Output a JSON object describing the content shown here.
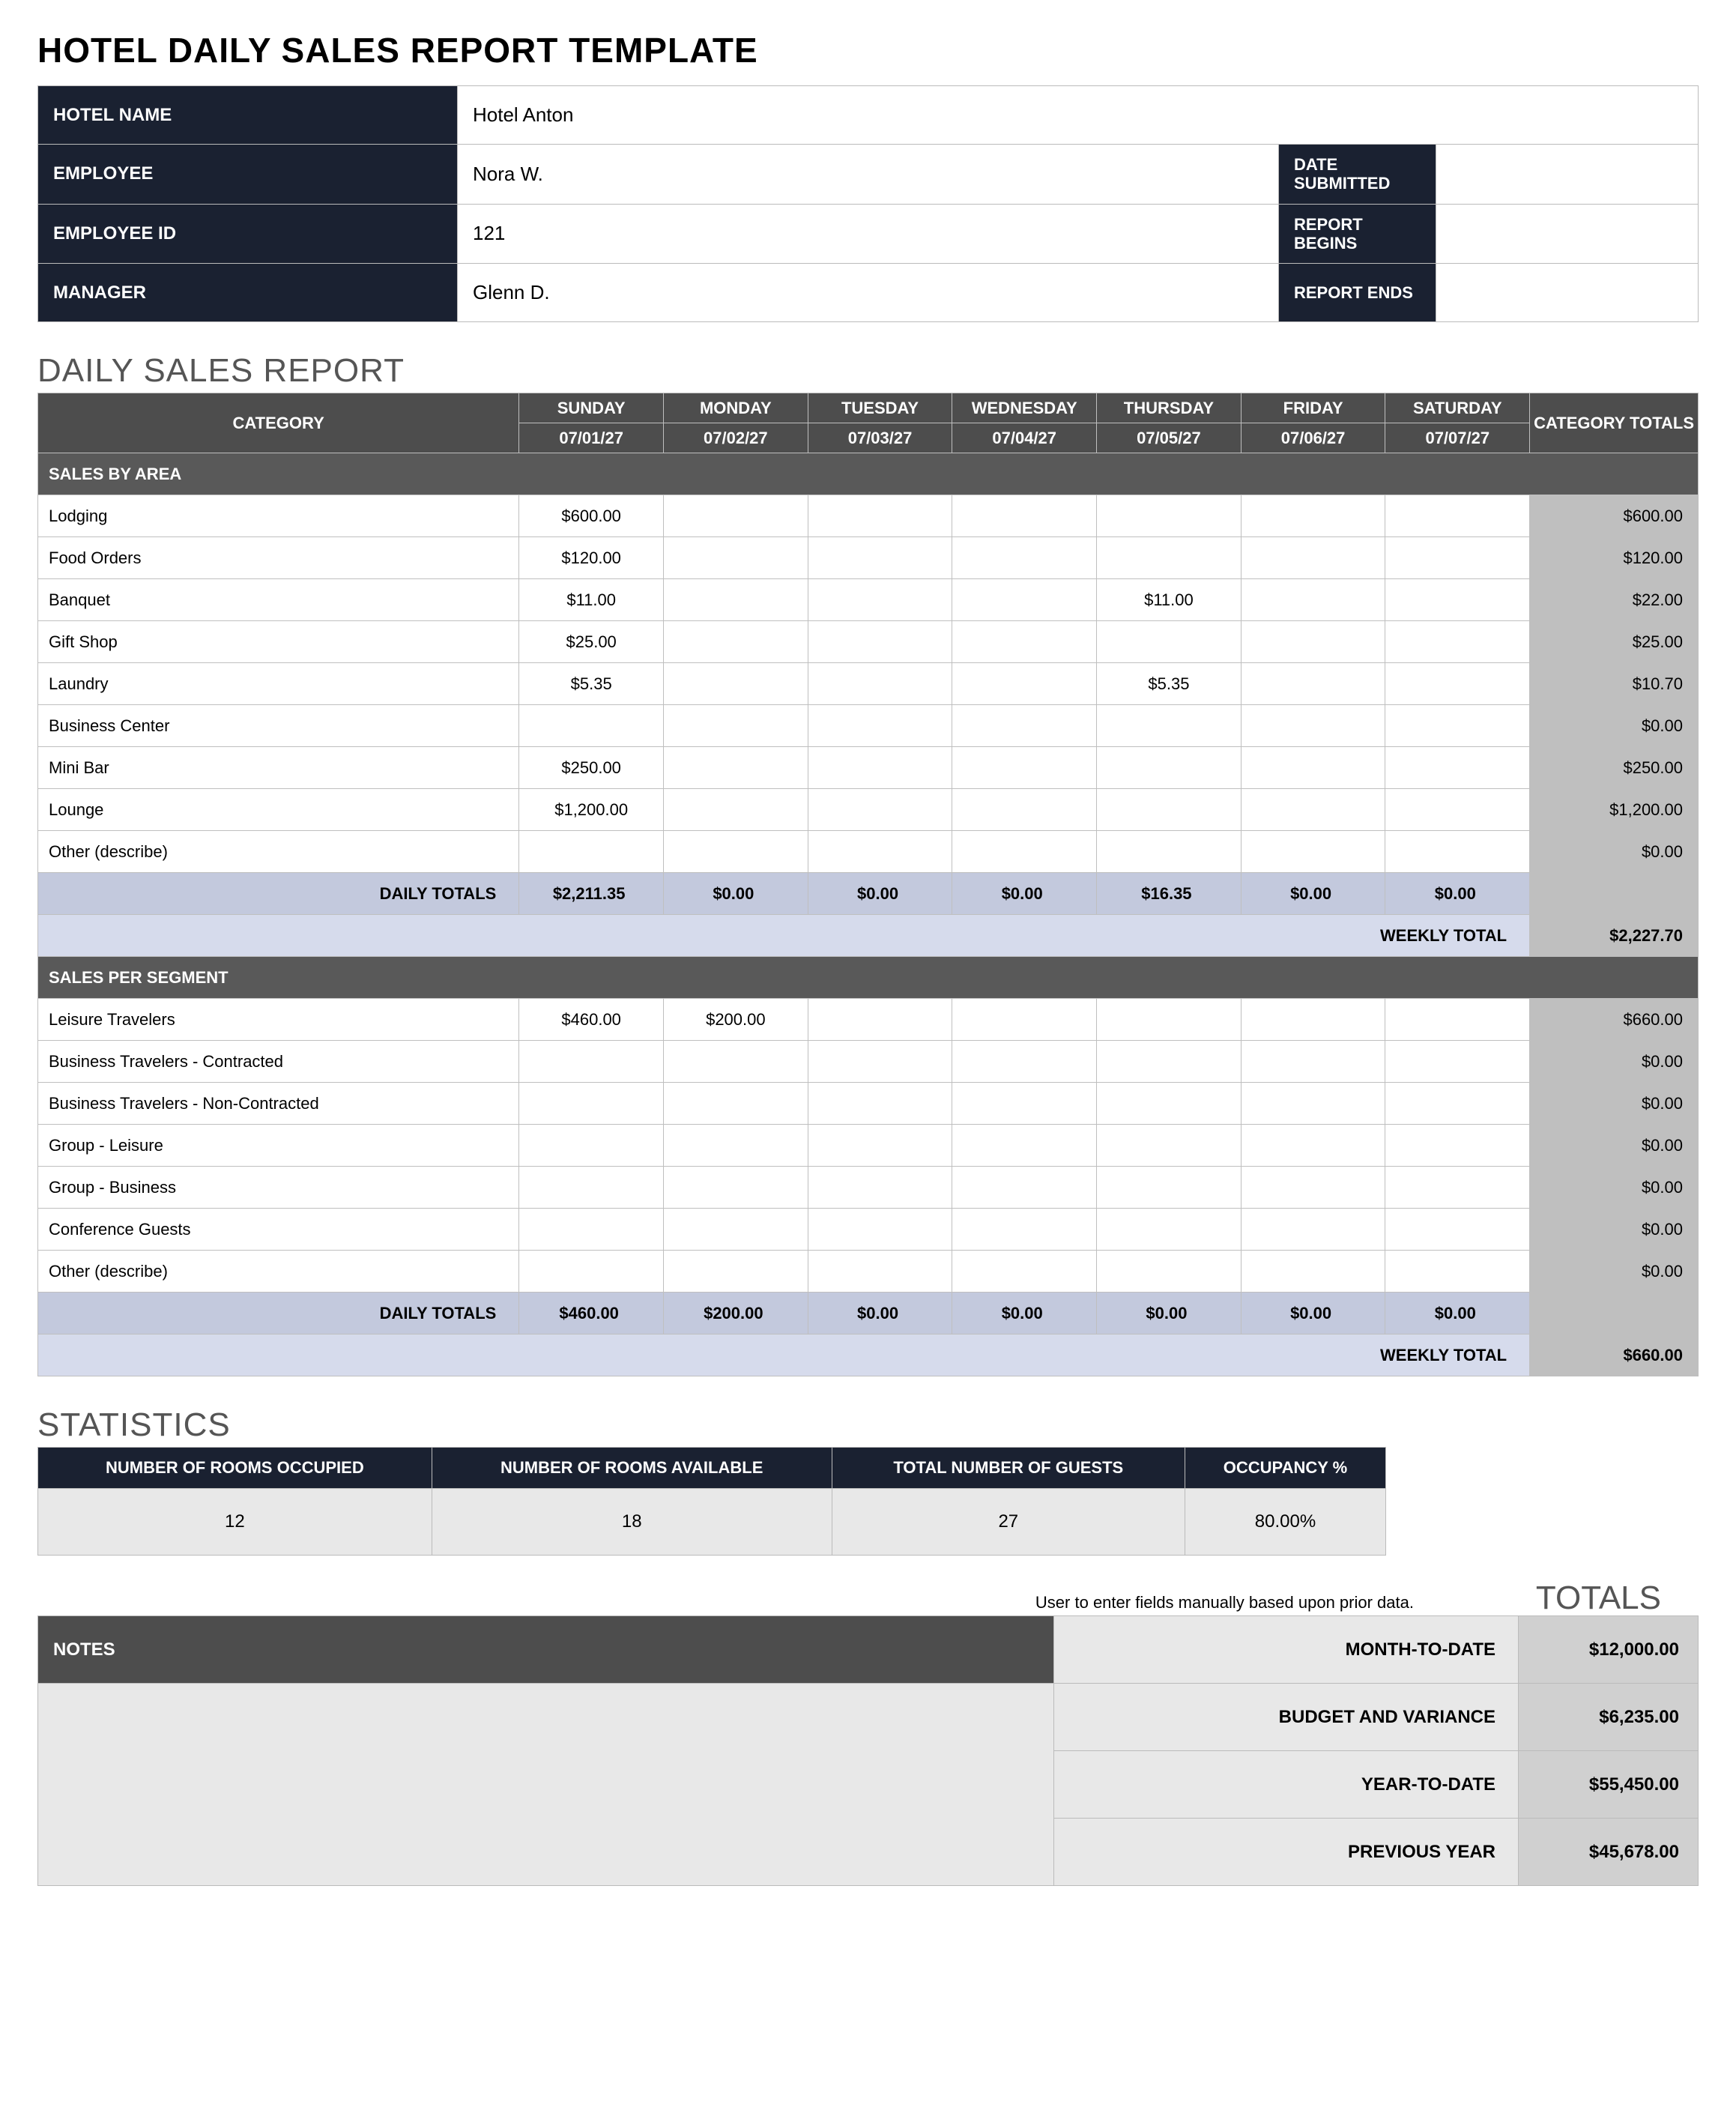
{
  "title": "HOTEL DAILY SALES REPORT TEMPLATE",
  "info": {
    "hotel_name_lbl": "HOTEL NAME",
    "hotel_name": "Hotel Anton",
    "employee_lbl": "EMPLOYEE",
    "employee": "Nora W.",
    "date_submitted_lbl": "DATE SUBMITTED",
    "date_submitted": "",
    "employee_id_lbl": "EMPLOYEE ID",
    "employee_id": "121",
    "report_begins_lbl": "REPORT BEGINS",
    "report_begins": "",
    "manager_lbl": "MANAGER",
    "manager": "Glenn D.",
    "report_ends_lbl": "REPORT ENDS",
    "report_ends": ""
  },
  "sales": {
    "section_title": "DAILY SALES REPORT",
    "headers": {
      "category": "CATEGORY",
      "days": [
        "SUNDAY",
        "MONDAY",
        "TUESDAY",
        "WEDNESDAY",
        "THURSDAY",
        "FRIDAY",
        "SATURDAY"
      ],
      "dates": [
        "07/01/27",
        "07/02/27",
        "07/03/27",
        "07/04/27",
        "07/05/27",
        "07/06/27",
        "07/07/27"
      ],
      "cat_totals": "CATEGORY TOTALS"
    },
    "group1": {
      "title": "SALES BY AREA",
      "rows": [
        {
          "name": "Lodging",
          "d": [
            "$600.00",
            "",
            "",
            "",
            "",
            "",
            ""
          ],
          "total": "$600.00"
        },
        {
          "name": "Food Orders",
          "d": [
            "$120.00",
            "",
            "",
            "",
            "",
            "",
            ""
          ],
          "total": "$120.00"
        },
        {
          "name": "Banquet",
          "d": [
            "$11.00",
            "",
            "",
            "",
            "$11.00",
            "",
            ""
          ],
          "total": "$22.00"
        },
        {
          "name": "Gift Shop",
          "d": [
            "$25.00",
            "",
            "",
            "",
            "",
            "",
            ""
          ],
          "total": "$25.00"
        },
        {
          "name": "Laundry",
          "d": [
            "$5.35",
            "",
            "",
            "",
            "$5.35",
            "",
            ""
          ],
          "total": "$10.70"
        },
        {
          "name": "Business Center",
          "d": [
            "",
            "",
            "",
            "",
            "",
            "",
            ""
          ],
          "total": "$0.00"
        },
        {
          "name": "Mini Bar",
          "d": [
            "$250.00",
            "",
            "",
            "",
            "",
            "",
            ""
          ],
          "total": "$250.00"
        },
        {
          "name": "Lounge",
          "d": [
            "$1,200.00",
            "",
            "",
            "",
            "",
            "",
            ""
          ],
          "total": "$1,200.00"
        },
        {
          "name": "Other (describe)",
          "d": [
            "",
            "",
            "",
            "",
            "",
            "",
            ""
          ],
          "total": "$0.00"
        }
      ],
      "daily_totals_lbl": "DAILY TOTALS",
      "daily_totals": [
        "$2,211.35",
        "$0.00",
        "$0.00",
        "$0.00",
        "$16.35",
        "$0.00",
        "$0.00"
      ],
      "weekly_total_lbl": "WEEKLY TOTAL",
      "weekly_total": "$2,227.70"
    },
    "group2": {
      "title": "SALES PER SEGMENT",
      "rows": [
        {
          "name": "Leisure Travelers",
          "d": [
            "$460.00",
            "$200.00",
            "",
            "",
            "",
            "",
            ""
          ],
          "total": "$660.00"
        },
        {
          "name": "Business Travelers - Contracted",
          "d": [
            "",
            "",
            "",
            "",
            "",
            "",
            ""
          ],
          "total": "$0.00"
        },
        {
          "name": "Business Travelers - Non-Contracted",
          "d": [
            "",
            "",
            "",
            "",
            "",
            "",
            ""
          ],
          "total": "$0.00"
        },
        {
          "name": "Group - Leisure",
          "d": [
            "",
            "",
            "",
            "",
            "",
            "",
            ""
          ],
          "total": "$0.00"
        },
        {
          "name": "Group - Business",
          "d": [
            "",
            "",
            "",
            "",
            "",
            "",
            ""
          ],
          "total": "$0.00"
        },
        {
          "name": "Conference Guests",
          "d": [
            "",
            "",
            "",
            "",
            "",
            "",
            ""
          ],
          "total": "$0.00"
        },
        {
          "name": "Other (describe)",
          "d": [
            "",
            "",
            "",
            "",
            "",
            "",
            ""
          ],
          "total": "$0.00"
        }
      ],
      "daily_totals_lbl": "DAILY TOTALS",
      "daily_totals": [
        "$460.00",
        "$200.00",
        "$0.00",
        "$0.00",
        "$0.00",
        "$0.00",
        "$0.00"
      ],
      "weekly_total_lbl": "WEEKLY TOTAL",
      "weekly_total": "$660.00"
    }
  },
  "stats": {
    "section_title": "STATISTICS",
    "headers": [
      "NUMBER OF ROOMS OCCUPIED",
      "NUMBER OF ROOMS AVAILABLE",
      "TOTAL NUMBER OF GUESTS",
      "OCCUPANCY %"
    ],
    "values": [
      "12",
      "18",
      "27",
      "80.00%"
    ]
  },
  "bottom": {
    "hint": "User to enter fields manually based upon prior data.",
    "totals_title": "TOTALS",
    "notes_lbl": "NOTES",
    "notes": "",
    "rows": [
      {
        "label": "MONTH-TO-DATE",
        "value": "$12,000.00"
      },
      {
        "label": "BUDGET AND VARIANCE",
        "value": "$6,235.00"
      },
      {
        "label": "YEAR-TO-DATE",
        "value": "$55,450.00"
      },
      {
        "label": "PREVIOUS YEAR",
        "value": "$45,678.00"
      }
    ]
  }
}
